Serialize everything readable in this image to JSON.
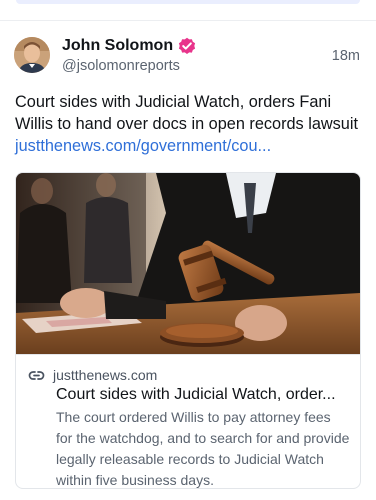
{
  "post": {
    "author_name": "John Solomon",
    "author_handle": "@jsolomonreports",
    "timestamp": "18m",
    "text": "Court sides with Judicial Watch, orders Fani Willis to hand over docs in open records lawsuit ",
    "link_text": "justthenews.com/government/cou...",
    "verified": true
  },
  "link_card": {
    "domain": "justthenews.com",
    "title": "Court sides with Judicial Watch, order...",
    "description": "The court ordered Willis to pay attorney fees for the watchdog, and to search for and provide legally releasable records to Judicial Watch within five business days.",
    "image_icon": "gavel-courtroom-photo"
  },
  "colors": {
    "link": "#2f6fd8",
    "verified_badge": "#e8348b",
    "secondary_text": "#5b6470"
  }
}
